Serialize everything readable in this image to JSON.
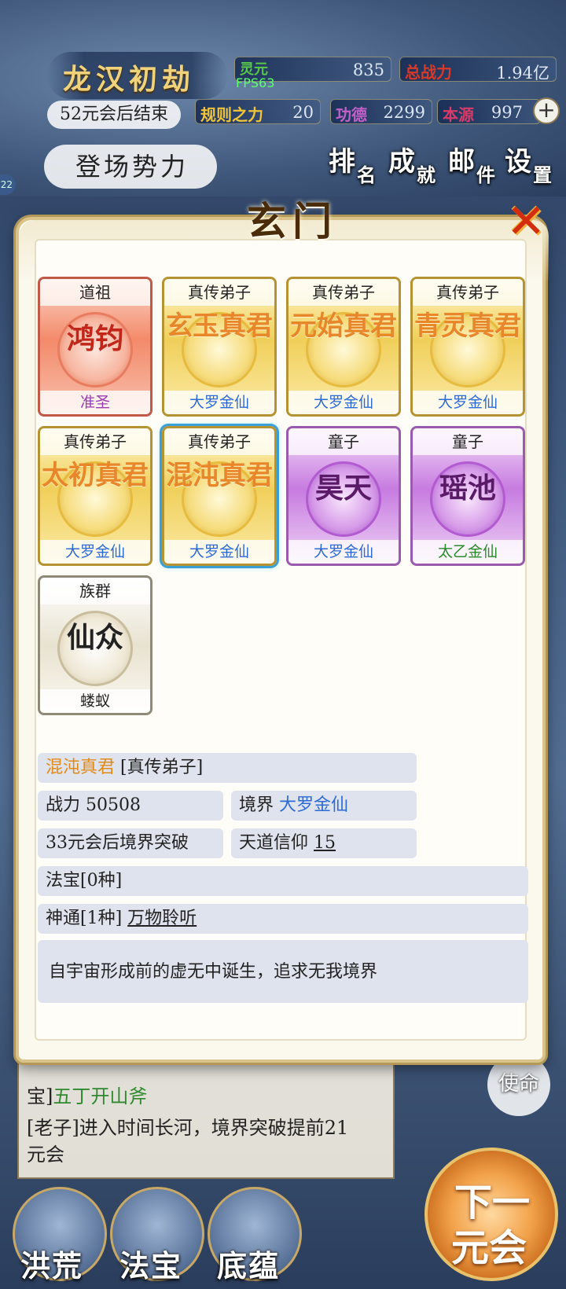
{
  "hud": {
    "world_title": "龙汉初劫",
    "countdown": "52元会后结束",
    "fps": "FPS63",
    "edge_badge": "22",
    "stats": {
      "lingyuan": {
        "label": "灵元",
        "value": "835"
      },
      "total_power": {
        "label": "总战力",
        "value": "1.94亿"
      },
      "rule_power": {
        "label": "规则之力",
        "value": "20"
      },
      "merit": {
        "label": "功德",
        "value": "2299"
      },
      "origin": {
        "label": "本源",
        "value": "997"
      }
    },
    "plus_label": "+",
    "enter_label": "登场势力",
    "menu": {
      "rank": {
        "main": "排",
        "sub": "名"
      },
      "achievement": {
        "main": "成",
        "sub": "就"
      },
      "mail": {
        "main": "邮",
        "sub": "件"
      },
      "settings": {
        "main": "设",
        "sub": "置"
      }
    }
  },
  "modal": {
    "title": "玄门",
    "close_label": "✕",
    "cards": [
      {
        "rank": "道祖",
        "name": "鸿钧",
        "realm": "准圣",
        "tier": "red"
      },
      {
        "rank": "真传弟子",
        "name": "玄玉真君",
        "realm": "大罗金仙",
        "tier": "gold"
      },
      {
        "rank": "真传弟子",
        "name": "元始真君",
        "realm": "大罗金仙",
        "tier": "gold"
      },
      {
        "rank": "真传弟子",
        "name": "青灵真君",
        "realm": "大罗金仙",
        "tier": "gold"
      },
      {
        "rank": "真传弟子",
        "name": "太初真君",
        "realm": "大罗金仙",
        "tier": "gold"
      },
      {
        "rank": "真传弟子",
        "name": "混沌真君",
        "realm": "大罗金仙",
        "tier": "gold"
      },
      {
        "rank": "童子",
        "name": "昊天",
        "realm": "大罗金仙",
        "tier": "purple"
      },
      {
        "rank": "童子",
        "name": "瑶池",
        "realm": "太乙金仙",
        "tier": "purple"
      },
      {
        "rank": "族群",
        "name": "仙众",
        "realm": "蝼蚁",
        "tier": "white"
      }
    ],
    "detail": {
      "name": "混沌真君",
      "rank": "[真传弟子]",
      "power_label": "战力",
      "power_value": "50508",
      "realm_label": "境界",
      "realm_value": "大罗金仙",
      "breakthrough": "33元会后境界突破",
      "faith_label": "天道信仰",
      "faith_value": "15",
      "treasure": "法宝[0种]",
      "ability_label": "神通[1种]",
      "ability_value": "万物聆听",
      "description": "自宇宙形成前的虚无中诞生，追求无我境界"
    }
  },
  "log": {
    "line1_prefix": "宝]",
    "line1_item": "五丁开山斧",
    "line2": "[老子]进入时间长河，境界突破提前21",
    "line3": "元会"
  },
  "mission_label": "使命",
  "bottom_nav": {
    "honghuang": "洪荒",
    "fabao": "法宝",
    "diyun": "底蕴",
    "next_line1": "下一",
    "next_line2": "元会"
  },
  "colors": {
    "modal_bg": "#fbf9ee",
    "gold_name": "#e8862a",
    "realm_blue": "#2c6ad6",
    "close_red": "#d22d0e",
    "selected_glow": "#3aa0d8"
  }
}
